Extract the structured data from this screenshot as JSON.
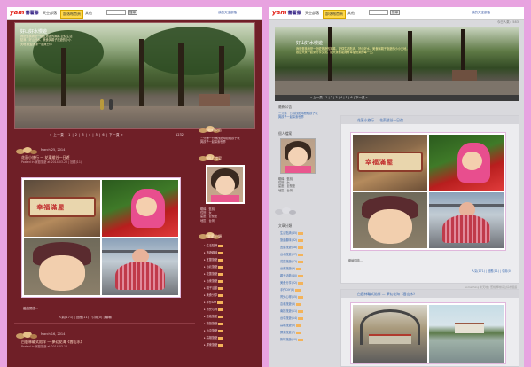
{
  "topbar": {
    "logo": "yam",
    "logo_cn": "蕃薯藤",
    "menu_friends": "天空部落",
    "menu_blog": "部落格首頁",
    "menu_extra": "其他",
    "search_button": "搜尋",
    "right_links": "我的天空部落",
    "right_links2": "登入 | 說明"
  },
  "left": {
    "banner_title": "好山好水慢遊",
    "banner_sub": "我是藍桃我是一個愛旅遊的媽媽\n記錄生活點滴、好山好水、美食與親子旅遊的小小天地\n歡迎大家一起來分享",
    "banner_foot": "",
    "pager": "« 上一頁 | 1 | 2 | 3 | 4 | 5 | 6 | 下一頁 »",
    "count": "1232",
    "posts": [
      {
        "date": "March 25, 2014",
        "title": "花蓮小旅行 — 花東縱谷一日遊",
        "meta": "Posted in 家庭旅遊 at 2014-03-25 | 回應(11)",
        "sign": "幸福滿屋",
        "more": "繼續閱讀...",
        "foot": "人氣(171) | 回應(11) | 引用(0) | 編輯"
      },
      {
        "date": "March 16, 2014",
        "title": "白鹿林輪式陪伴 — 夢幻花海《雲山水》",
        "meta": "Posted in 家庭旅遊 at 2014-03-16"
      }
    ],
    "side": {
      "h_news": "最新公告",
      "news_text": "三分鐘一分鐘找點時間陪孩子玩\n與孩子一起探索世界",
      "h_profile": "個人檔案",
      "profile": "暱稱：藍桃\n性別：女\n星座：巨蟹座\n地區：台灣",
      "h_cat": "文章分類",
      "cats": [
        "生活點滴",
        "旅遊趣味",
        "宜蘭旅遊",
        "台北旅遊",
        "花蓮旅遊",
        "台東旅遊",
        "親子活動",
        "美食分享",
        "手作DIY",
        "育兒心得",
        "嘉義旅遊",
        "南投旅遊",
        "台中旅遊",
        "高雄旅遊",
        "屏東旅遊"
      ]
    }
  },
  "right": {
    "banner_title": "好山好水慢遊",
    "banner_sub": "我是藍桃我是一個愛旅遊的媽媽，記錄生活點滴、好山好水、美食與親子旅遊的小小天地，歡迎大家一起來分享交流。願大家都能擁有幸福快樂的每一天。",
    "nav": "« 上一頁 | 1 | 2 | 3 | 4 | 5 | 6 | 下一頁 »",
    "count": "今日人氣：583",
    "side": {
      "h_news": "最新公告",
      "news_text": "三分鐘一分鐘找點時間陪孩子玩\n與孩子一起探索世界",
      "h_profile": "個人檔案",
      "profile": "暱稱：藍桃\n性別：女\n星座：巨蟹座\n地區：台灣",
      "h_cat": "文章分類",
      "cats": [
        "生活點滴(45)",
        "旅遊趣味(32)",
        "宜蘭旅遊(18)",
        "台北旅遊(27)",
        "花蓮旅遊(12)",
        "台東旅遊(9)",
        "親子活動(40)",
        "美食分享(22)",
        "手作DIY(8)",
        "育兒心得(15)",
        "嘉義旅遊(6)",
        "南投旅遊(11)",
        "台中旅遊(14)",
        "高雄旅遊(5)",
        "屏東旅遊(7)",
        "新竹旅遊(10)"
      ]
    },
    "posts": [
      {
        "date": "2014/03/25",
        "title": "花蓮小旅行 — 花東縱谷一日遊",
        "sign": "幸福滿屋",
        "more": "繼續閱讀...",
        "foot": "人氣(171) | 回應(11) | 引用(0)"
      },
      {
        "date": "2014/03/16",
        "title": "白鹿林輪式陪伴 — 夢幻花海《雲山水》"
      }
    ],
    "watermark": "Something 新天地 | 藍桃媽咪好山好水慢遊"
  },
  "colors": {
    "left_bg": "#6f1f27",
    "right_bg": "#d9d9dd",
    "page_bg": "#e8a3e0",
    "accent_yellow": "#ffd84a"
  }
}
